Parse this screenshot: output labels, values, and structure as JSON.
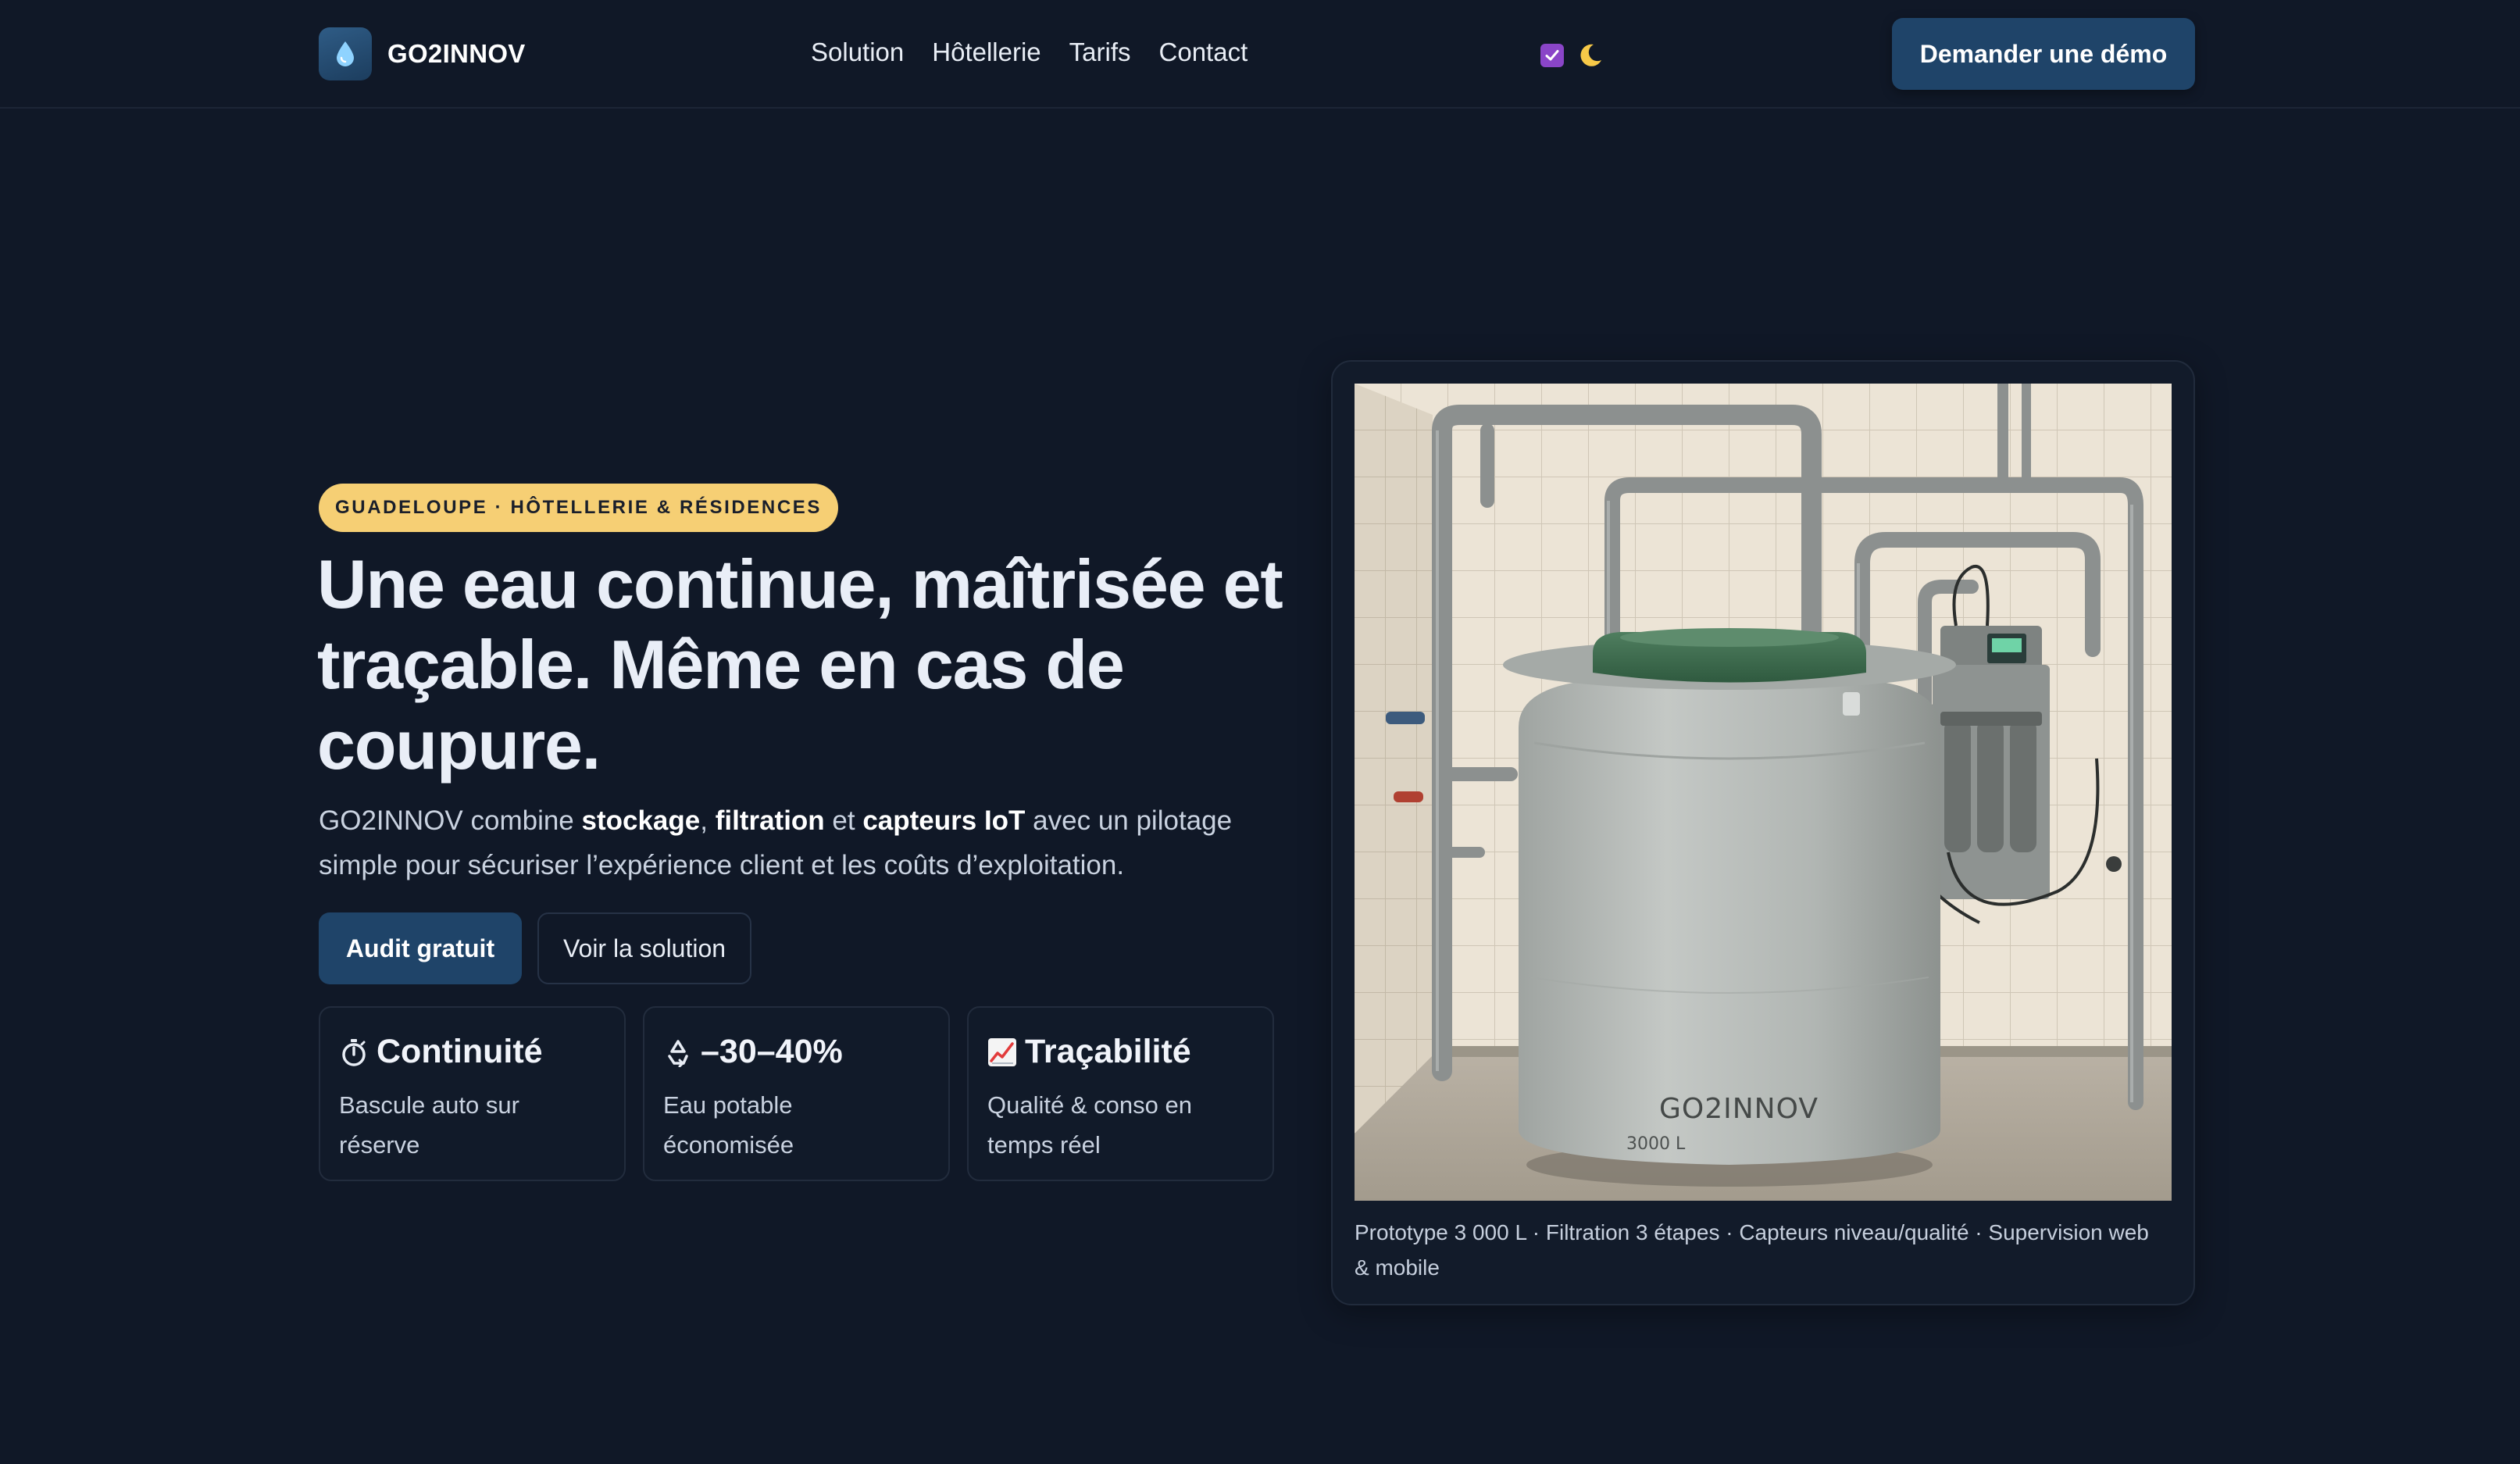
{
  "header": {
    "brand_name": "GO2INNOV",
    "brand_icon": "water-drop-icon",
    "nav": [
      {
        "label": "Solution"
      },
      {
        "label": "Hôtellerie"
      },
      {
        "label": "Tarifs"
      },
      {
        "label": "Contact"
      }
    ],
    "theme_toggle_icon": "moon-icon",
    "cta_label": "Demander une démo"
  },
  "hero": {
    "badge": "GUADELOUPE · HÔTELLERIE & RÉSIDENCES",
    "title": "Une eau continue, maîtrisée et traçable. Même en cas de coupure.",
    "subtitle": {
      "p1": "GO2INNOV combine ",
      "b1": "stockage",
      "p2": ", ",
      "b2": "filtration",
      "p3": " et ",
      "b3": "capteurs IoT",
      "p4": " avec un pilotage simple pour sécuriser l’expérience client et les coûts d’exploitation."
    },
    "primary_cta": "Audit gratuit",
    "secondary_cta": "Voir la solution",
    "stats": [
      {
        "icon": "stopwatch-icon",
        "title": "Continuité",
        "desc": "Bascule auto sur réserve"
      },
      {
        "icon": "recycle-icon",
        "title": "–30–40%",
        "desc": "Eau potable économisée"
      },
      {
        "icon": "chart-up-icon",
        "title": "Traçabilité",
        "desc": "Qualité & conso en temps réel"
      }
    ]
  },
  "product": {
    "tank_brand": "GO2INNOV",
    "tank_capacity": "3000 L",
    "caption": "Prototype 3 000 L · Filtration 3 étapes · Capteurs niveau/qualité · Supervision web & mobile"
  },
  "colors": {
    "background": "#101827",
    "accent_button": "#1f4469",
    "badge": "#f6cf74",
    "checkbox": "#8a45c8"
  }
}
